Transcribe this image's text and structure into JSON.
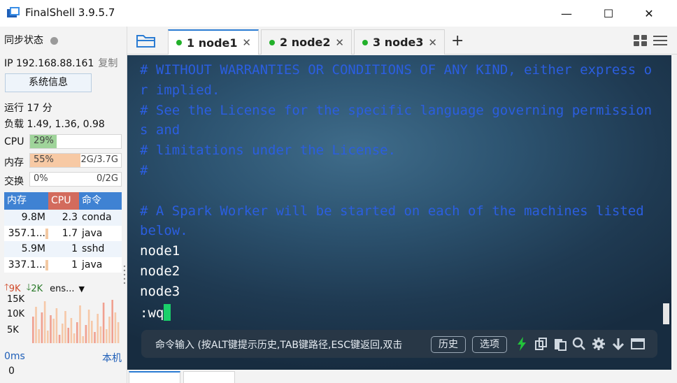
{
  "window": {
    "title": "FinalShell 3.9.5.7",
    "minimize": "—",
    "maximize": "☐",
    "close": "✕"
  },
  "sidebar": {
    "sync_label": "同步状态",
    "ip_label": "IP 192.168.88.161",
    "copy_label": "复制",
    "sysinfo_button": "系统信息",
    "uptime": "运行 17 分",
    "load": "负载 1.49, 1.36, 0.98",
    "cpu": {
      "label": "CPU",
      "percent_text": "29%",
      "fraction": 0.29,
      "color": "#9fd49a"
    },
    "mem": {
      "label": "内存",
      "percent_text": "55%",
      "value": "2G/3.7G",
      "fraction": 0.55,
      "color": "#f7c9a4"
    },
    "swap": {
      "label": "交换",
      "percent_text": "0%",
      "value": "0/2G",
      "fraction": 0.0
    },
    "process_table": {
      "headers": [
        "内存",
        "CPU",
        "命令"
      ],
      "rows": [
        {
          "mem": "9.8M",
          "cpu": "2.3",
          "cmd": "conda"
        },
        {
          "mem": "357.1...",
          "cpu": "1.7",
          "cmd": "java"
        },
        {
          "mem": "5.9M",
          "cpu": "1",
          "cmd": "sshd"
        },
        {
          "mem": "337.1...",
          "cpu": "1",
          "cmd": "java"
        }
      ]
    },
    "network": {
      "up": "9K",
      "down": "2K",
      "iface": "ens...",
      "ticks": [
        "15K",
        "10K",
        "5K"
      ]
    },
    "latency": {
      "value": "0ms",
      "host": "本机",
      "below": "0"
    }
  },
  "tabs": [
    {
      "label": "1 node1",
      "active": true
    },
    {
      "label": "2 node2",
      "active": false
    },
    {
      "label": "3 node3",
      "active": false
    }
  ],
  "terminal": {
    "lines": [
      {
        "text": "# WITHOUT WARRANTIES OR CONDITIONS OF ANY KIND, either express o",
        "kind": "comment"
      },
      {
        "text": "r implied.",
        "kind": "comment"
      },
      {
        "text": "# See the License for the specific language governing permission",
        "kind": "comment"
      },
      {
        "text": "s and",
        "kind": "comment"
      },
      {
        "text": "# limitations under the License.",
        "kind": "comment"
      },
      {
        "text": "#",
        "kind": "comment"
      },
      {
        "text": "",
        "kind": "blank"
      },
      {
        "text": "# A Spark Worker will be started on each of the machines listed",
        "kind": "comment"
      },
      {
        "text": "below.",
        "kind": "comment"
      },
      {
        "text": "node1",
        "kind": "text"
      },
      {
        "text": "node2",
        "kind": "text"
      },
      {
        "text": "node3",
        "kind": "text"
      },
      {
        "text": ":wq",
        "kind": "prompt"
      }
    ]
  },
  "command_bar": {
    "placeholder": "命令输入 (按ALT键提示历史,TAB键路径,ESC键返回,双击",
    "history_button": "历史",
    "options_button": "选项"
  }
}
